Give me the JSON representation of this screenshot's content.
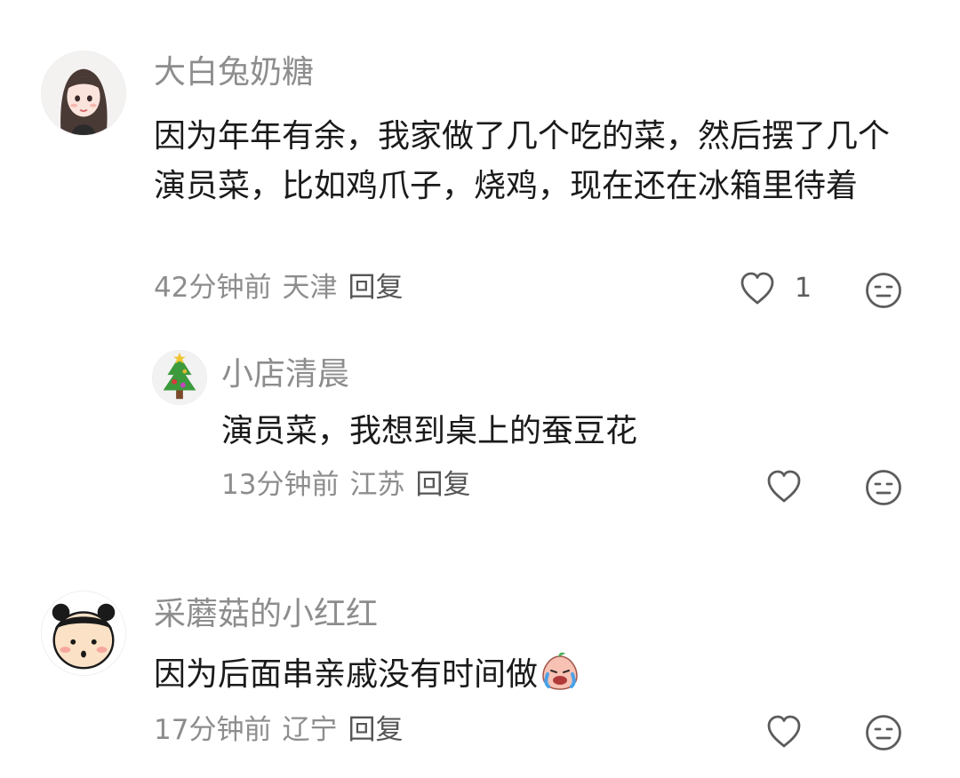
{
  "comments": [
    {
      "username": "大白兔奶糖",
      "text": "因为年年有余，我家做了几个吃的菜，然后摆了几个演员菜，比如鸡爪子，烧鸡，现在还在冰箱里待着",
      "time": "42分钟前",
      "location": "天津",
      "reply_label": "回复",
      "like_count": "1",
      "avatar_icon": "girl-avatar-icon",
      "replies": [
        {
          "username": "小店清晨",
          "text": "演员菜，我想到桌上的蚕豆花",
          "time": "13分钟前",
          "location": "江苏",
          "reply_label": "回复",
          "avatar_icon": "christmas-tree-avatar-icon"
        }
      ]
    },
    {
      "username": "采蘑菇的小红红",
      "text": "因为后面串亲戚没有时间做",
      "emoji": "crying-peach-emoji",
      "time": "17分钟前",
      "location": "辽宁",
      "reply_label": "回复",
      "avatar_icon": "cartoon-face-avatar-icon"
    }
  ],
  "colors": {
    "username": "#8d8d8d",
    "text": "#1a1a1a",
    "meta": "#8d8d8d",
    "icon": "#5c5c5c"
  }
}
